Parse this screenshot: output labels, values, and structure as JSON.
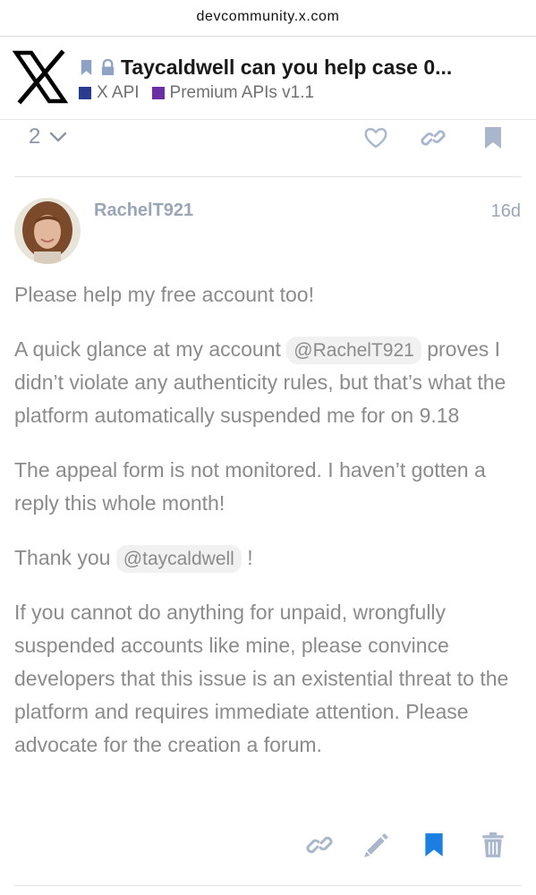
{
  "browser": {
    "url": "devcommunity.x.com"
  },
  "header": {
    "logo_icon": "x-logo-icon",
    "status_icons": [
      "bookmark-icon",
      "lock-icon"
    ],
    "title": "Taycaldwell can you help case 0...",
    "categories": [
      {
        "label": "X API",
        "color": "#2a3a8f"
      },
      {
        "label": "Premium APIs v1.1",
        "color": "#6b2fa3"
      }
    ]
  },
  "previous_post": {
    "replies_count": "2",
    "actions": [
      "chevron-down-icon",
      "heart-icon",
      "link-icon",
      "bookmark-icon"
    ]
  },
  "post": {
    "username": "RachelT921",
    "age": "16d",
    "paragraphs": {
      "p1": "Please help my free account too!",
      "p2_before": "A quick glance at my account",
      "p2_mention": "@RachelT921",
      "p2_after": "proves I didn’t violate any authenticity rules, but that’s what the platform automatically suspended me for on 9.18",
      "p3": "The appeal form is not monitored. I haven’t gotten a reply this whole month!",
      "p4_before": "Thank you",
      "p4_mention": "@taycaldwell",
      "p4_after": "!",
      "p5": "If you cannot do anything for unpaid, wrongfully suspended accounts like mine, please convince developers that this issue is an existential threat to the platform and requires immediate attention. Please advocate for the creation a forum."
    },
    "actions": [
      "link-icon",
      "pencil-icon",
      "bookmark-icon",
      "trash-icon"
    ]
  },
  "colors": {
    "muted_icon": "#a9b6cc",
    "bookmark_active": "#1a7fe0",
    "text": "#8b8b8b"
  }
}
